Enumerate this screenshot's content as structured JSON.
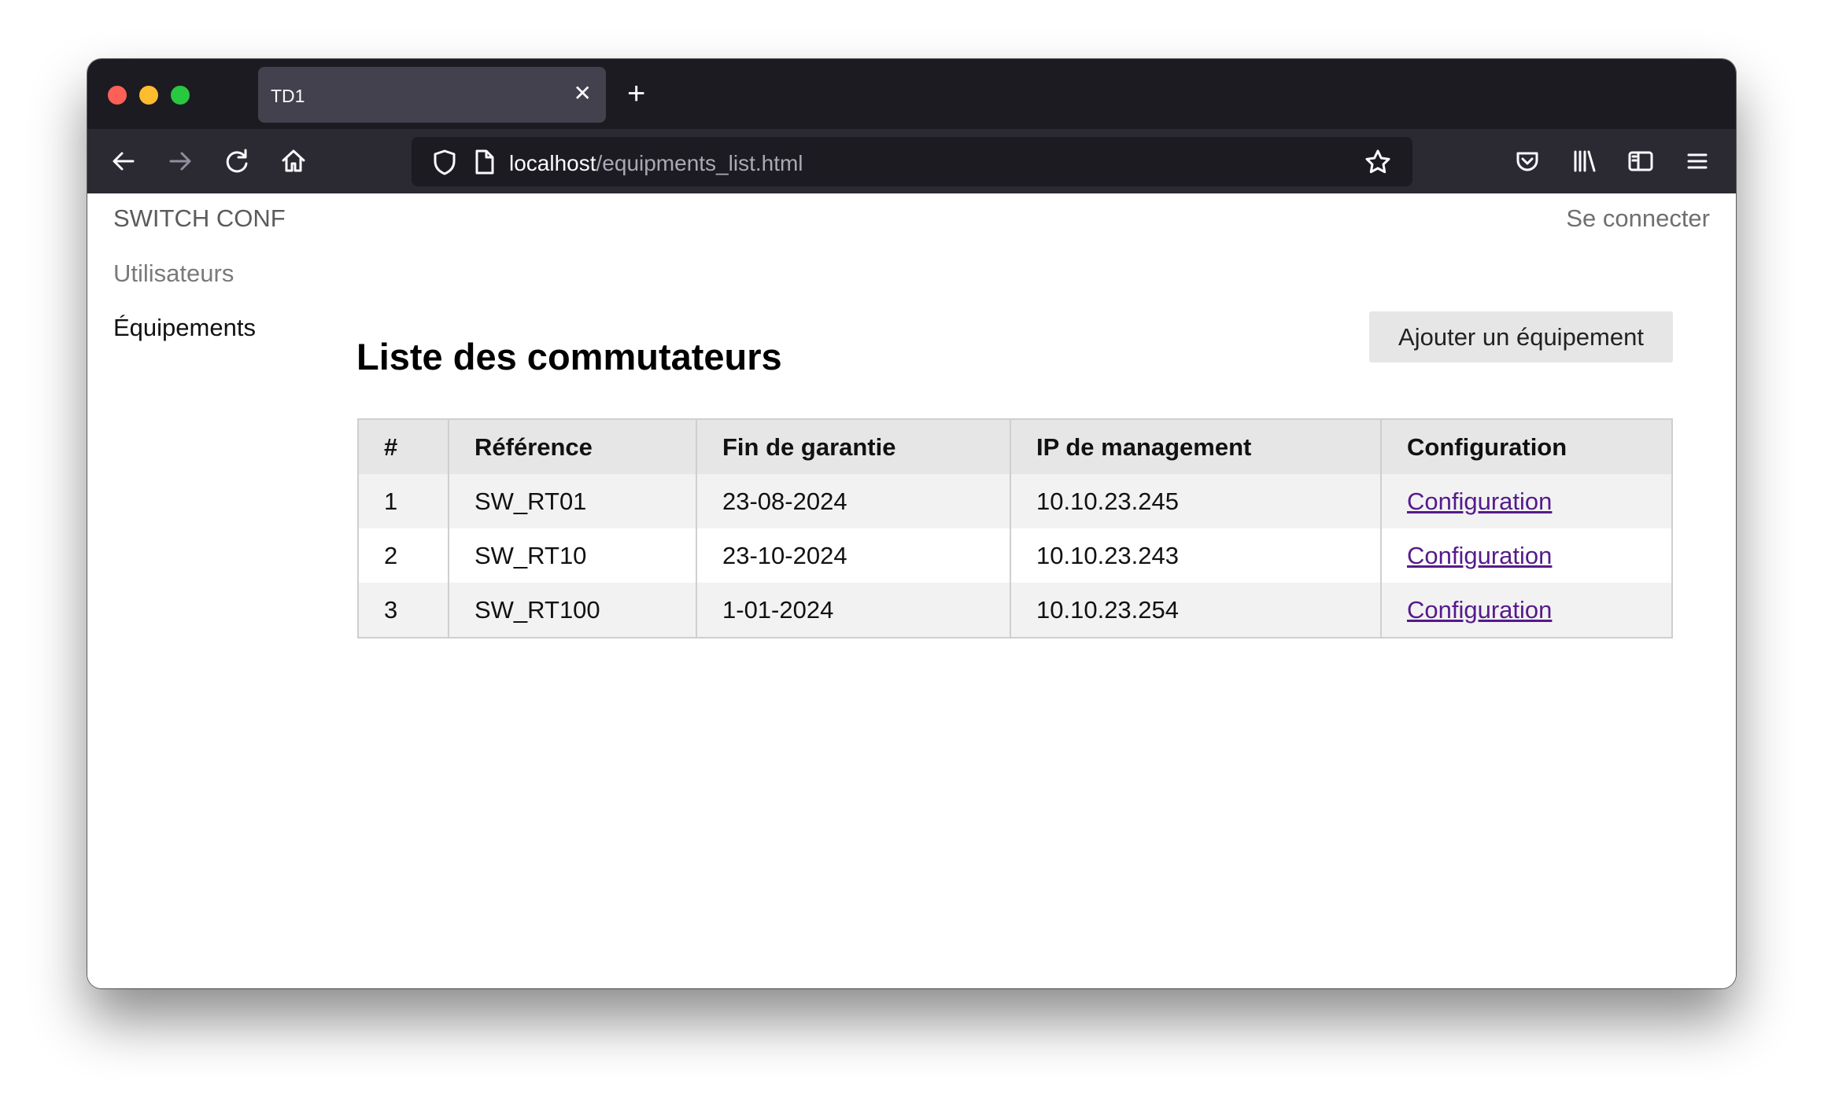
{
  "browser": {
    "tab_title": "TD1",
    "tab_close": "✕",
    "new_tab": "+",
    "url_host": "localhost",
    "url_path": "/equipments_list.html"
  },
  "header": {
    "brand": "SWITCH CONF",
    "login": "Se connecter"
  },
  "sidebar": {
    "items": [
      {
        "label": "Utilisateurs"
      },
      {
        "label": "Équipements"
      }
    ]
  },
  "main": {
    "title": "Liste des commutateurs",
    "add_button": "Ajouter un équipement",
    "table": {
      "headers": [
        "#",
        "Référence",
        "Fin de garantie",
        "IP de management",
        "Configuration"
      ],
      "rows": [
        {
          "id": "1",
          "ref": "SW_RT01",
          "warranty": "23-08-2024",
          "ip": "10.10.23.245",
          "link": "Configuration"
        },
        {
          "id": "2",
          "ref": "SW_RT10",
          "warranty": "23-10-2024",
          "ip": "10.10.23.243",
          "link": "Configuration"
        },
        {
          "id": "3",
          "ref": "SW_RT100",
          "warranty": "1-01-2024",
          "ip": "10.10.23.254",
          "link": "Configuration"
        }
      ]
    }
  },
  "colors": {
    "tabbar_bg": "#1c1b22",
    "toolbar_bg": "#2b2a33",
    "visited_link": "#551a8b",
    "header_row_bg": "#e6e6e6",
    "stripe_bg": "#f2f2f2"
  }
}
